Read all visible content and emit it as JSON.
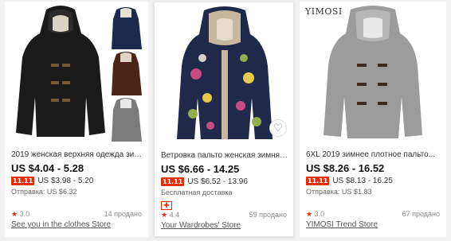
{
  "products": [
    {
      "title": "2019 женская верхняя одежда зим...",
      "price": "US $4.04 - 5.28",
      "promo_badge": "11.11",
      "promo_price": "US $3.98 - 5.20",
      "shipping": "Отправка: US $6.32",
      "rating": "3.0",
      "sold": "14 продано",
      "store": "See you in the clothes Store",
      "image_icon": "black-hooded-coat-with-thumbnails"
    },
    {
      "title": "Ветровка пальто женская зимняя...",
      "price": "US $6.66 - 14.25",
      "promo_badge": "11.11",
      "promo_price": "US $6.52 - 13.96",
      "shipping": "Бесплатная доставка",
      "gift_icon": "gift-icon",
      "rating": "4.4",
      "sold": "59 продано",
      "store": "Your Wardrobes' Store",
      "image_icon": "floral-navy-hooded-coat"
    },
    {
      "title": "6XL 2019 зимнее плотное пальто...",
      "price": "US $8.26 - 16.52",
      "promo_badge": "11.11",
      "promo_price": "US $8.13 - 16.25",
      "shipping": "Отправка: US $1.83",
      "rating": "3.0",
      "sold": "67 продано",
      "store": "YIMOSI Trend Store",
      "brand": "YIMOSI",
      "image_icon": "grey-toggle-coat"
    }
  ],
  "colors": {
    "accent": "#e62e04",
    "badge_ad": "#ff9800"
  }
}
